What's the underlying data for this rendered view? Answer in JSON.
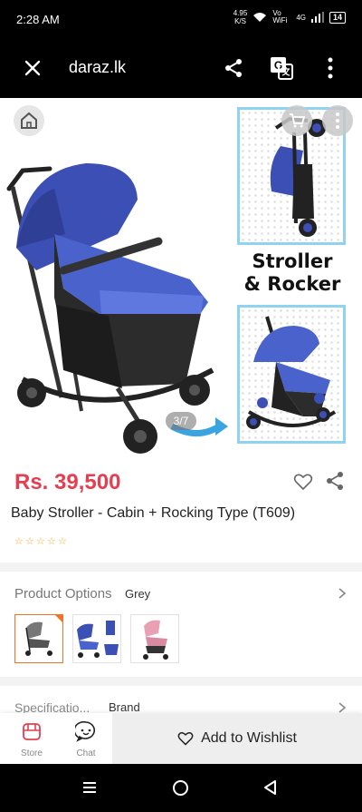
{
  "status": {
    "time": "2:28 AM",
    "speed_value": "4.95",
    "speed_unit": "K/S",
    "network": "Vo WiFi",
    "signal": "4G",
    "battery": "14"
  },
  "toolbar": {
    "site": "daraz.lk"
  },
  "gallery": {
    "counter": "3/7",
    "banner_line1": "Stroller",
    "banner_line2": "& Rocker"
  },
  "product": {
    "price": "Rs. 39,500",
    "title": "Baby Stroller - Cabin + Rocking Type (T609)",
    "rating_stars": 0,
    "star_glyphs": [
      "☆",
      "☆",
      "☆",
      "☆",
      "☆"
    ]
  },
  "options": {
    "label": "Product Options",
    "value": "Grey",
    "variants": [
      "grey",
      "blue",
      "pink"
    ]
  },
  "specs": {
    "label": "Specificatio...",
    "value": "Brand"
  },
  "bottom": {
    "store_label": "Store",
    "chat_label": "Chat",
    "wishlist_label": "Add to Wishlist"
  },
  "colors": {
    "price": "#e53e50",
    "accent": "#f57224",
    "panel_border": "#8fd3f0",
    "stroller_blue": "#3b4fb5"
  }
}
